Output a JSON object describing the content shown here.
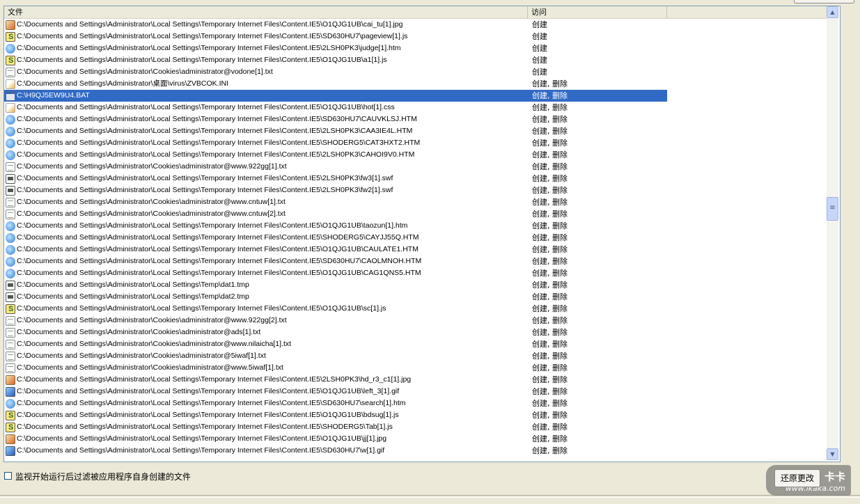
{
  "columns": {
    "file": "文件",
    "access": "访问"
  },
  "rows": [
    {
      "icon": "jpg",
      "path": "C:\\Documents and Settings\\Administrator\\Local Settings\\Temporary Internet Files\\Content.IE5\\O1QJG1UB\\cai_tu[1].jpg",
      "access": "创建"
    },
    {
      "icon": "js",
      "path": "C:\\Documents and Settings\\Administrator\\Local Settings\\Temporary Internet Files\\Content.IE5\\SD630HU7\\pageview[1].js",
      "access": "创建"
    },
    {
      "icon": "ie",
      "path": "C:\\Documents and Settings\\Administrator\\Local Settings\\Temporary Internet Files\\Content.IE5\\2LSH0PK3\\judge[1].htm",
      "access": "创建"
    },
    {
      "icon": "js",
      "path": "C:\\Documents and Settings\\Administrator\\Local Settings\\Temporary Internet Files\\Content.IE5\\O1QJG1UB\\a1[1].js",
      "access": "创建"
    },
    {
      "icon": "txt",
      "path": "C:\\Documents and Settings\\Administrator\\Cookies\\administrator@vodone[1].txt",
      "access": "创建"
    },
    {
      "icon": "ini",
      "path": "C:\\Documents and Settings\\Administrator\\桌面\\virus\\ZVBCOK.INI",
      "access": "创建, 删除"
    },
    {
      "icon": "bat",
      "path": "C:\\H9QJ5EW9U4.BAT",
      "access": "创建, 删除",
      "selected": true
    },
    {
      "icon": "ini",
      "path": "C:\\Documents and Settings\\Administrator\\Local Settings\\Temporary Internet Files\\Content.IE5\\O1QJG1UB\\hot[1].css",
      "access": "创建, 删除"
    },
    {
      "icon": "ie",
      "path": "C:\\Documents and Settings\\Administrator\\Local Settings\\Temporary Internet Files\\Content.IE5\\SD630HU7\\CAUVKLSJ.HTM",
      "access": "创建, 删除"
    },
    {
      "icon": "ie",
      "path": "C:\\Documents and Settings\\Administrator\\Local Settings\\Temporary Internet Files\\Content.IE5\\2LSH0PK3\\CAA3IE4L.HTM",
      "access": "创建, 删除"
    },
    {
      "icon": "ie",
      "path": "C:\\Documents and Settings\\Administrator\\Local Settings\\Temporary Internet Files\\Content.IE5\\SHODERG5\\CAT3HXT2.HTM",
      "access": "创建, 删除"
    },
    {
      "icon": "ie",
      "path": "C:\\Documents and Settings\\Administrator\\Local Settings\\Temporary Internet Files\\Content.IE5\\2LSH0PK3\\CAHOI9V0.HTM",
      "access": "创建, 删除"
    },
    {
      "icon": "txt",
      "path": "C:\\Documents and Settings\\Administrator\\Cookies\\administrator@www.922gg[1].txt",
      "access": "创建, 删除"
    },
    {
      "icon": "swf",
      "path": "C:\\Documents and Settings\\Administrator\\Local Settings\\Temporary Internet Files\\Content.IE5\\2LSH0PK3\\fw3[1].swf",
      "access": "创建, 删除"
    },
    {
      "icon": "swf",
      "path": "C:\\Documents and Settings\\Administrator\\Local Settings\\Temporary Internet Files\\Content.IE5\\2LSH0PK3\\fw2[1].swf",
      "access": "创建, 删除"
    },
    {
      "icon": "txt",
      "path": "C:\\Documents and Settings\\Administrator\\Cookies\\administrator@www.cntuw[1].txt",
      "access": "创建, 删除"
    },
    {
      "icon": "txt",
      "path": "C:\\Documents and Settings\\Administrator\\Cookies\\administrator@www.cntuw[2].txt",
      "access": "创建, 删除"
    },
    {
      "icon": "ie",
      "path": "C:\\Documents and Settings\\Administrator\\Local Settings\\Temporary Internet Files\\Content.IE5\\O1QJG1UB\\taozun[1].htm",
      "access": "创建, 删除"
    },
    {
      "icon": "ie",
      "path": "C:\\Documents and Settings\\Administrator\\Local Settings\\Temporary Internet Files\\Content.IE5\\SHODERG5\\CAYJJ55Q.HTM",
      "access": "创建, 删除"
    },
    {
      "icon": "ie",
      "path": "C:\\Documents and Settings\\Administrator\\Local Settings\\Temporary Internet Files\\Content.IE5\\O1QJG1UB\\CAULATE1.HTM",
      "access": "创建, 删除"
    },
    {
      "icon": "ie",
      "path": "C:\\Documents and Settings\\Administrator\\Local Settings\\Temporary Internet Files\\Content.IE5\\SD630HU7\\CAOLMNOH.HTM",
      "access": "创建, 删除"
    },
    {
      "icon": "ie",
      "path": "C:\\Documents and Settings\\Administrator\\Local Settings\\Temporary Internet Files\\Content.IE5\\O1QJG1UB\\CAG1QNS5.HTM",
      "access": "创建, 删除"
    },
    {
      "icon": "swf",
      "path": "C:\\Documents and Settings\\Administrator\\Local Settings\\Temp\\dat1.tmp",
      "access": "创建, 删除"
    },
    {
      "icon": "swf",
      "path": "C:\\Documents and Settings\\Administrator\\Local Settings\\Temp\\dat2.tmp",
      "access": "创建, 删除"
    },
    {
      "icon": "js",
      "path": "C:\\Documents and Settings\\Administrator\\Local Settings\\Temporary Internet Files\\Content.IE5\\O1QJG1UB\\sc[1].js",
      "access": "创建, 删除"
    },
    {
      "icon": "txt",
      "path": "C:\\Documents and Settings\\Administrator\\Cookies\\administrator@www.922gg[2].txt",
      "access": "创建, 删除"
    },
    {
      "icon": "txt",
      "path": "C:\\Documents and Settings\\Administrator\\Cookies\\administrator@ads[1].txt",
      "access": "创建, 删除"
    },
    {
      "icon": "txt",
      "path": "C:\\Documents and Settings\\Administrator\\Cookies\\administrator@www.nilaicha[1].txt",
      "access": "创建, 删除"
    },
    {
      "icon": "txt",
      "path": "C:\\Documents and Settings\\Administrator\\Cookies\\administrator@5iwaf[1].txt",
      "access": "创建, 删除"
    },
    {
      "icon": "txt",
      "path": "C:\\Documents and Settings\\Administrator\\Cookies\\administrator@www.5iwaf[1].txt",
      "access": "创建, 删除"
    },
    {
      "icon": "jpg",
      "path": "C:\\Documents and Settings\\Administrator\\Local Settings\\Temporary Internet Files\\Content.IE5\\2LSH0PK3\\hd_r3_c1[1].jpg",
      "access": "创建, 删除"
    },
    {
      "icon": "gif",
      "path": "C:\\Documents and Settings\\Administrator\\Local Settings\\Temporary Internet Files\\Content.IE5\\O1QJG1UB\\left_3[1].gif",
      "access": "创建, 删除"
    },
    {
      "icon": "ie",
      "path": "C:\\Documents and Settings\\Administrator\\Local Settings\\Temporary Internet Files\\Content.IE5\\SD630HU7\\search[1].htm",
      "access": "创建, 删除"
    },
    {
      "icon": "js",
      "path": "C:\\Documents and Settings\\Administrator\\Local Settings\\Temporary Internet Files\\Content.IE5\\O1QJG1UB\\bdsug[1].js",
      "access": "创建, 删除"
    },
    {
      "icon": "js",
      "path": "C:\\Documents and Settings\\Administrator\\Local Settings\\Temporary Internet Files\\Content.IE5\\SHODERG5\\Tab[1].js",
      "access": "创建, 删除"
    },
    {
      "icon": "jpg",
      "path": "C:\\Documents and Settings\\Administrator\\Local Settings\\Temporary Internet Files\\Content.IE5\\O1QJG1UB\\jj[1].jpg",
      "access": "创建, 删除"
    },
    {
      "icon": "gif",
      "path": "C:\\Documents and Settings\\Administrator\\Local Settings\\Temporary Internet Files\\Content.IE5\\SD630HU7\\w[1].gif",
      "access": "创建, 删除"
    }
  ],
  "filter_checkbox": {
    "label": "监视开始运行后过滤被应用程序自身创建的文件",
    "checked": false
  },
  "restore_button": "还原更改",
  "watermark": {
    "line1": "卡卡",
    "line2": "www.ikaka.com"
  }
}
